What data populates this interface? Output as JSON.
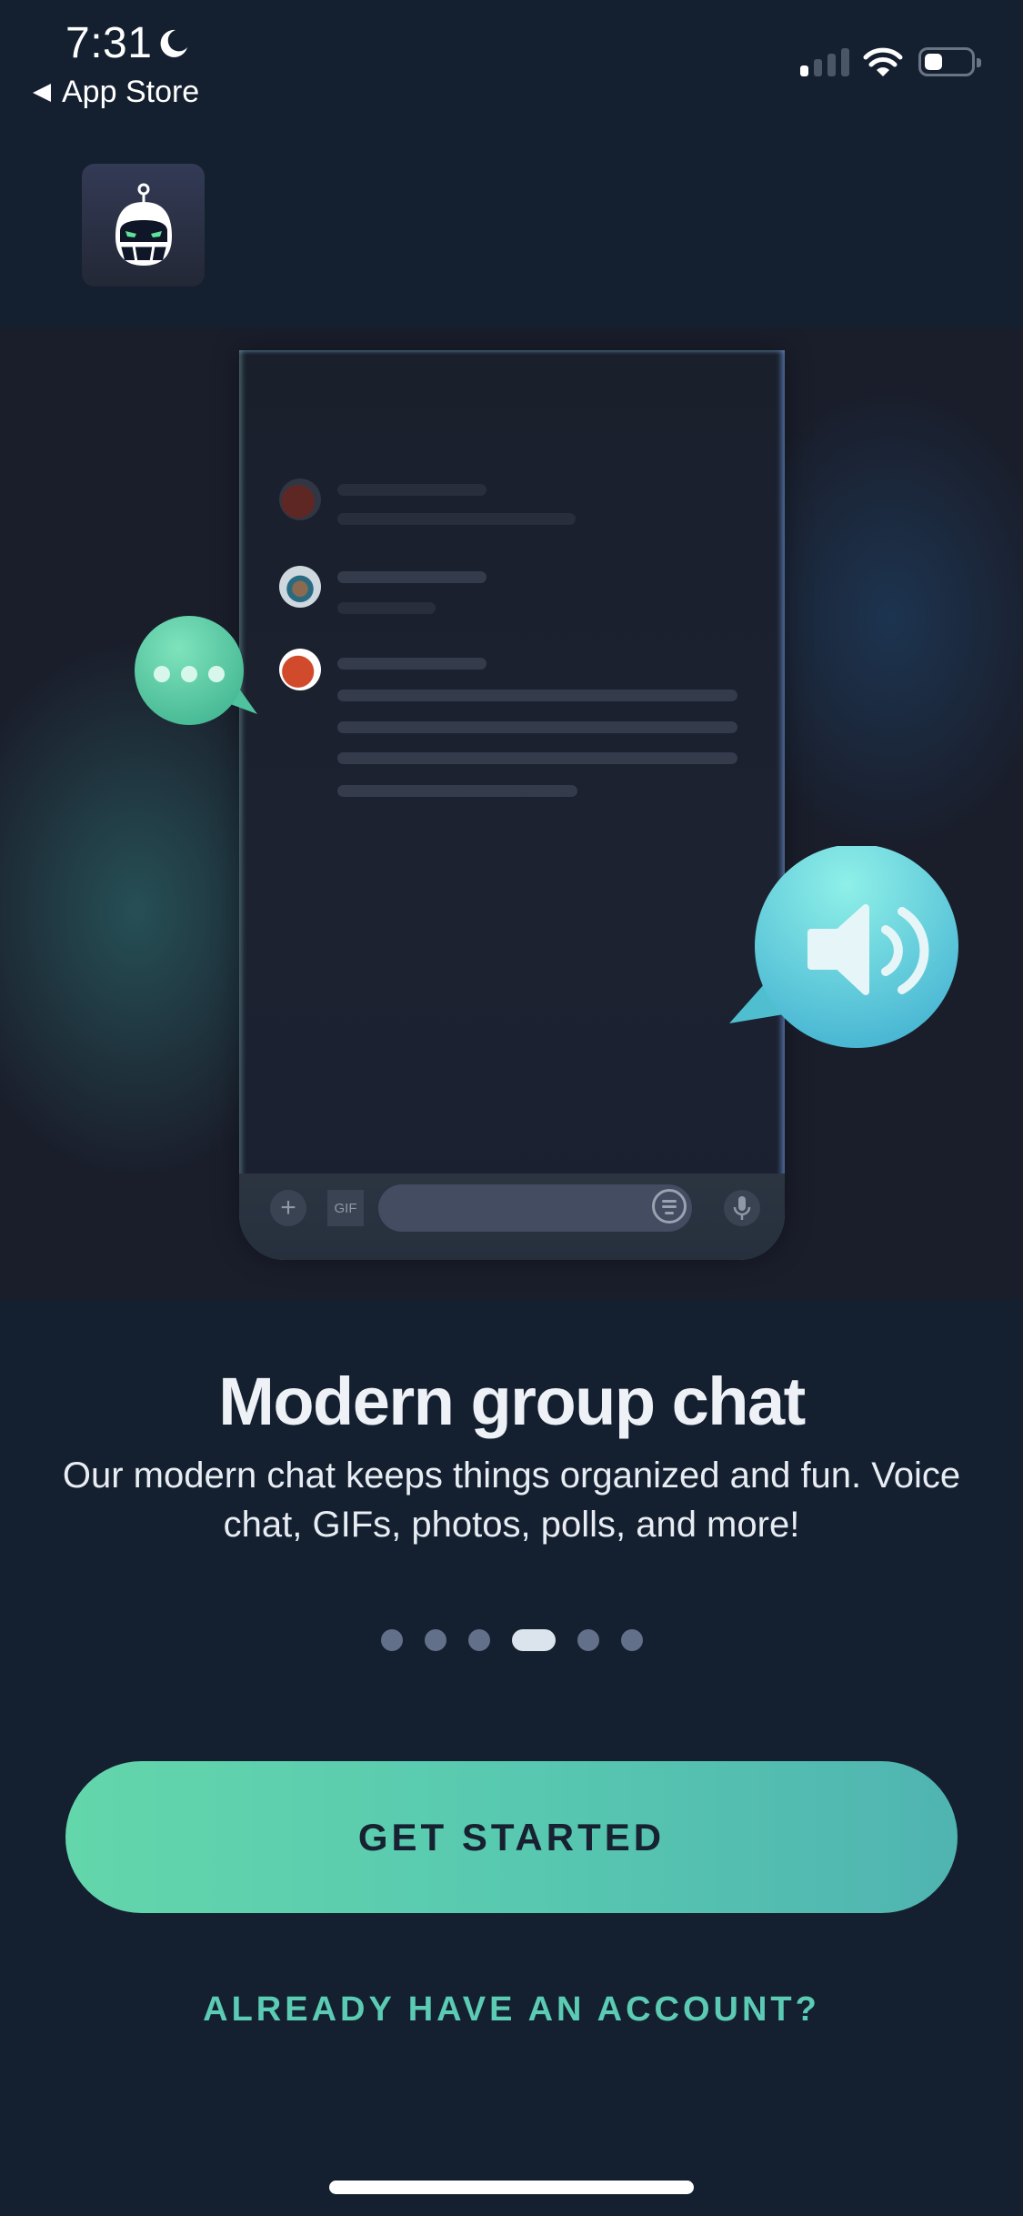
{
  "status_bar": {
    "time": "7:31",
    "focus_icon": "moon-icon",
    "back_label": "App Store",
    "signal_bars_active": 1,
    "signal_bars_total": 4,
    "wifi_icon": "wifi-icon",
    "battery_level": 0.4
  },
  "app": {
    "logo_icon": "robot-football-helmet-logo"
  },
  "illustration": {
    "chat_preview": {
      "messages": [
        {
          "avatar": "helmet-avatar-faded",
          "name_line": true,
          "text_lines": 1
        },
        {
          "avatar": "mascot-avatar",
          "name_line": true,
          "text_lines": 1
        },
        {
          "avatar": "helmet-avatar",
          "name_line": true,
          "text_lines": 4
        }
      ],
      "composer": {
        "add_icon": "plus-icon",
        "gif_label": "GIF",
        "keyboard_icon": "keyboard-icon",
        "mic_icon": "microphone-icon"
      }
    },
    "bubbles": [
      {
        "icon": "typing-dots-icon",
        "color": "#5fd1a8"
      },
      {
        "icon": "speaker-icon",
        "color": "#5ccbd6"
      }
    ]
  },
  "onboarding": {
    "title": "Modern group chat",
    "description": "Our modern chat keeps things organized and fun. Voice chat, GIFs, photos, polls, and more!",
    "page_count": 6,
    "active_page": 4
  },
  "actions": {
    "primary_label": "GET STARTED",
    "secondary_label": "ALREADY HAVE AN ACCOUNT?"
  },
  "colors": {
    "background": "#142030",
    "accent": "#5ccbb4",
    "button_gradient_start": "#63d6ab",
    "button_gradient_end": "#50b4b1",
    "button_text": "#172131"
  }
}
